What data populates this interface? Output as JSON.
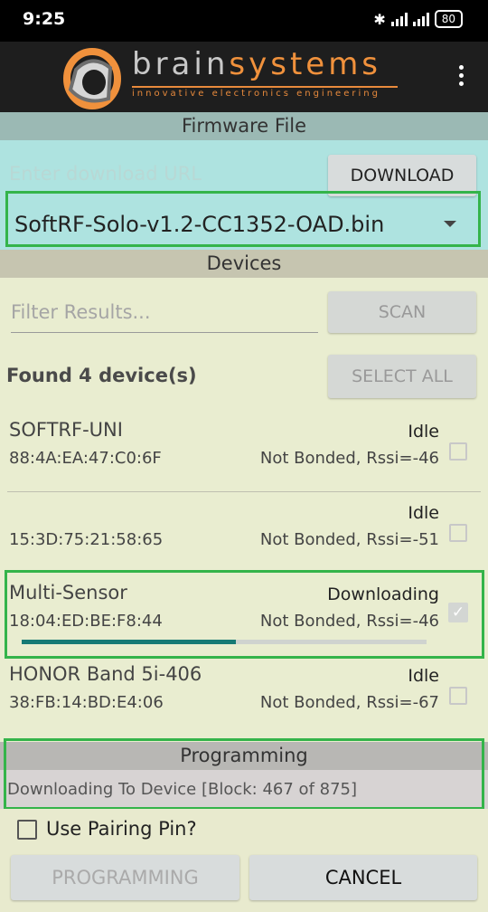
{
  "status_bar": {
    "time": "9:25",
    "battery": "80",
    "icons": [
      "bluetooth-icon",
      "signal-icon",
      "signal-icon",
      "battery-icon"
    ]
  },
  "app_bar": {
    "brand_part1": "brain",
    "brand_part2": "systems",
    "tagline": "innovative electronics engineering",
    "menu_icon": "more-vert-icon",
    "accent_color": "#f0913c"
  },
  "firmware": {
    "header": "Firmware File",
    "url_placeholder": "Enter download URL",
    "download_label": "DOWNLOAD",
    "selected_file": "SoftRF-Solo-v1.2-CC1352-OAD.bin"
  },
  "devices": {
    "header": "Devices",
    "filter_placeholder": "Filter Results...",
    "scan_label": "SCAN",
    "found_label": "Found 4 device(s)",
    "select_all_label": "SELECT ALL",
    "list": [
      {
        "name": "SOFTRF-UNI",
        "mac": "88:4A:EA:47:C0:6F",
        "state": "Idle",
        "info": "Not Bonded, Rssi=-46",
        "checked": false
      },
      {
        "name": "",
        "mac": "15:3D:75:21:58:65",
        "state": "Idle",
        "info": "Not Bonded, Rssi=-51",
        "checked": false
      },
      {
        "name": "Multi-Sensor",
        "mac": "18:04:ED:BE:F8:44",
        "state": "Downloading",
        "info": "Not Bonded, Rssi=-46",
        "checked": true,
        "progress": 0.53
      },
      {
        "name": "HONOR Band 5i-406",
        "mac": "38:FB:14:BD:E4:06",
        "state": "Idle",
        "info": "Not Bonded, Rssi=-67",
        "checked": false
      }
    ]
  },
  "programming": {
    "header": "Programming",
    "status": "Downloading To Device [Block: 467 of 875]",
    "pairing_pin_label": "Use Pairing Pin?",
    "program_label": "PROGRAMMING",
    "cancel_label": "CANCEL"
  },
  "colors": {
    "highlight": "#34b44a",
    "progress": "#167a75",
    "firmware_bg": "#aee3e0",
    "content_bg": "#e9edd0"
  }
}
